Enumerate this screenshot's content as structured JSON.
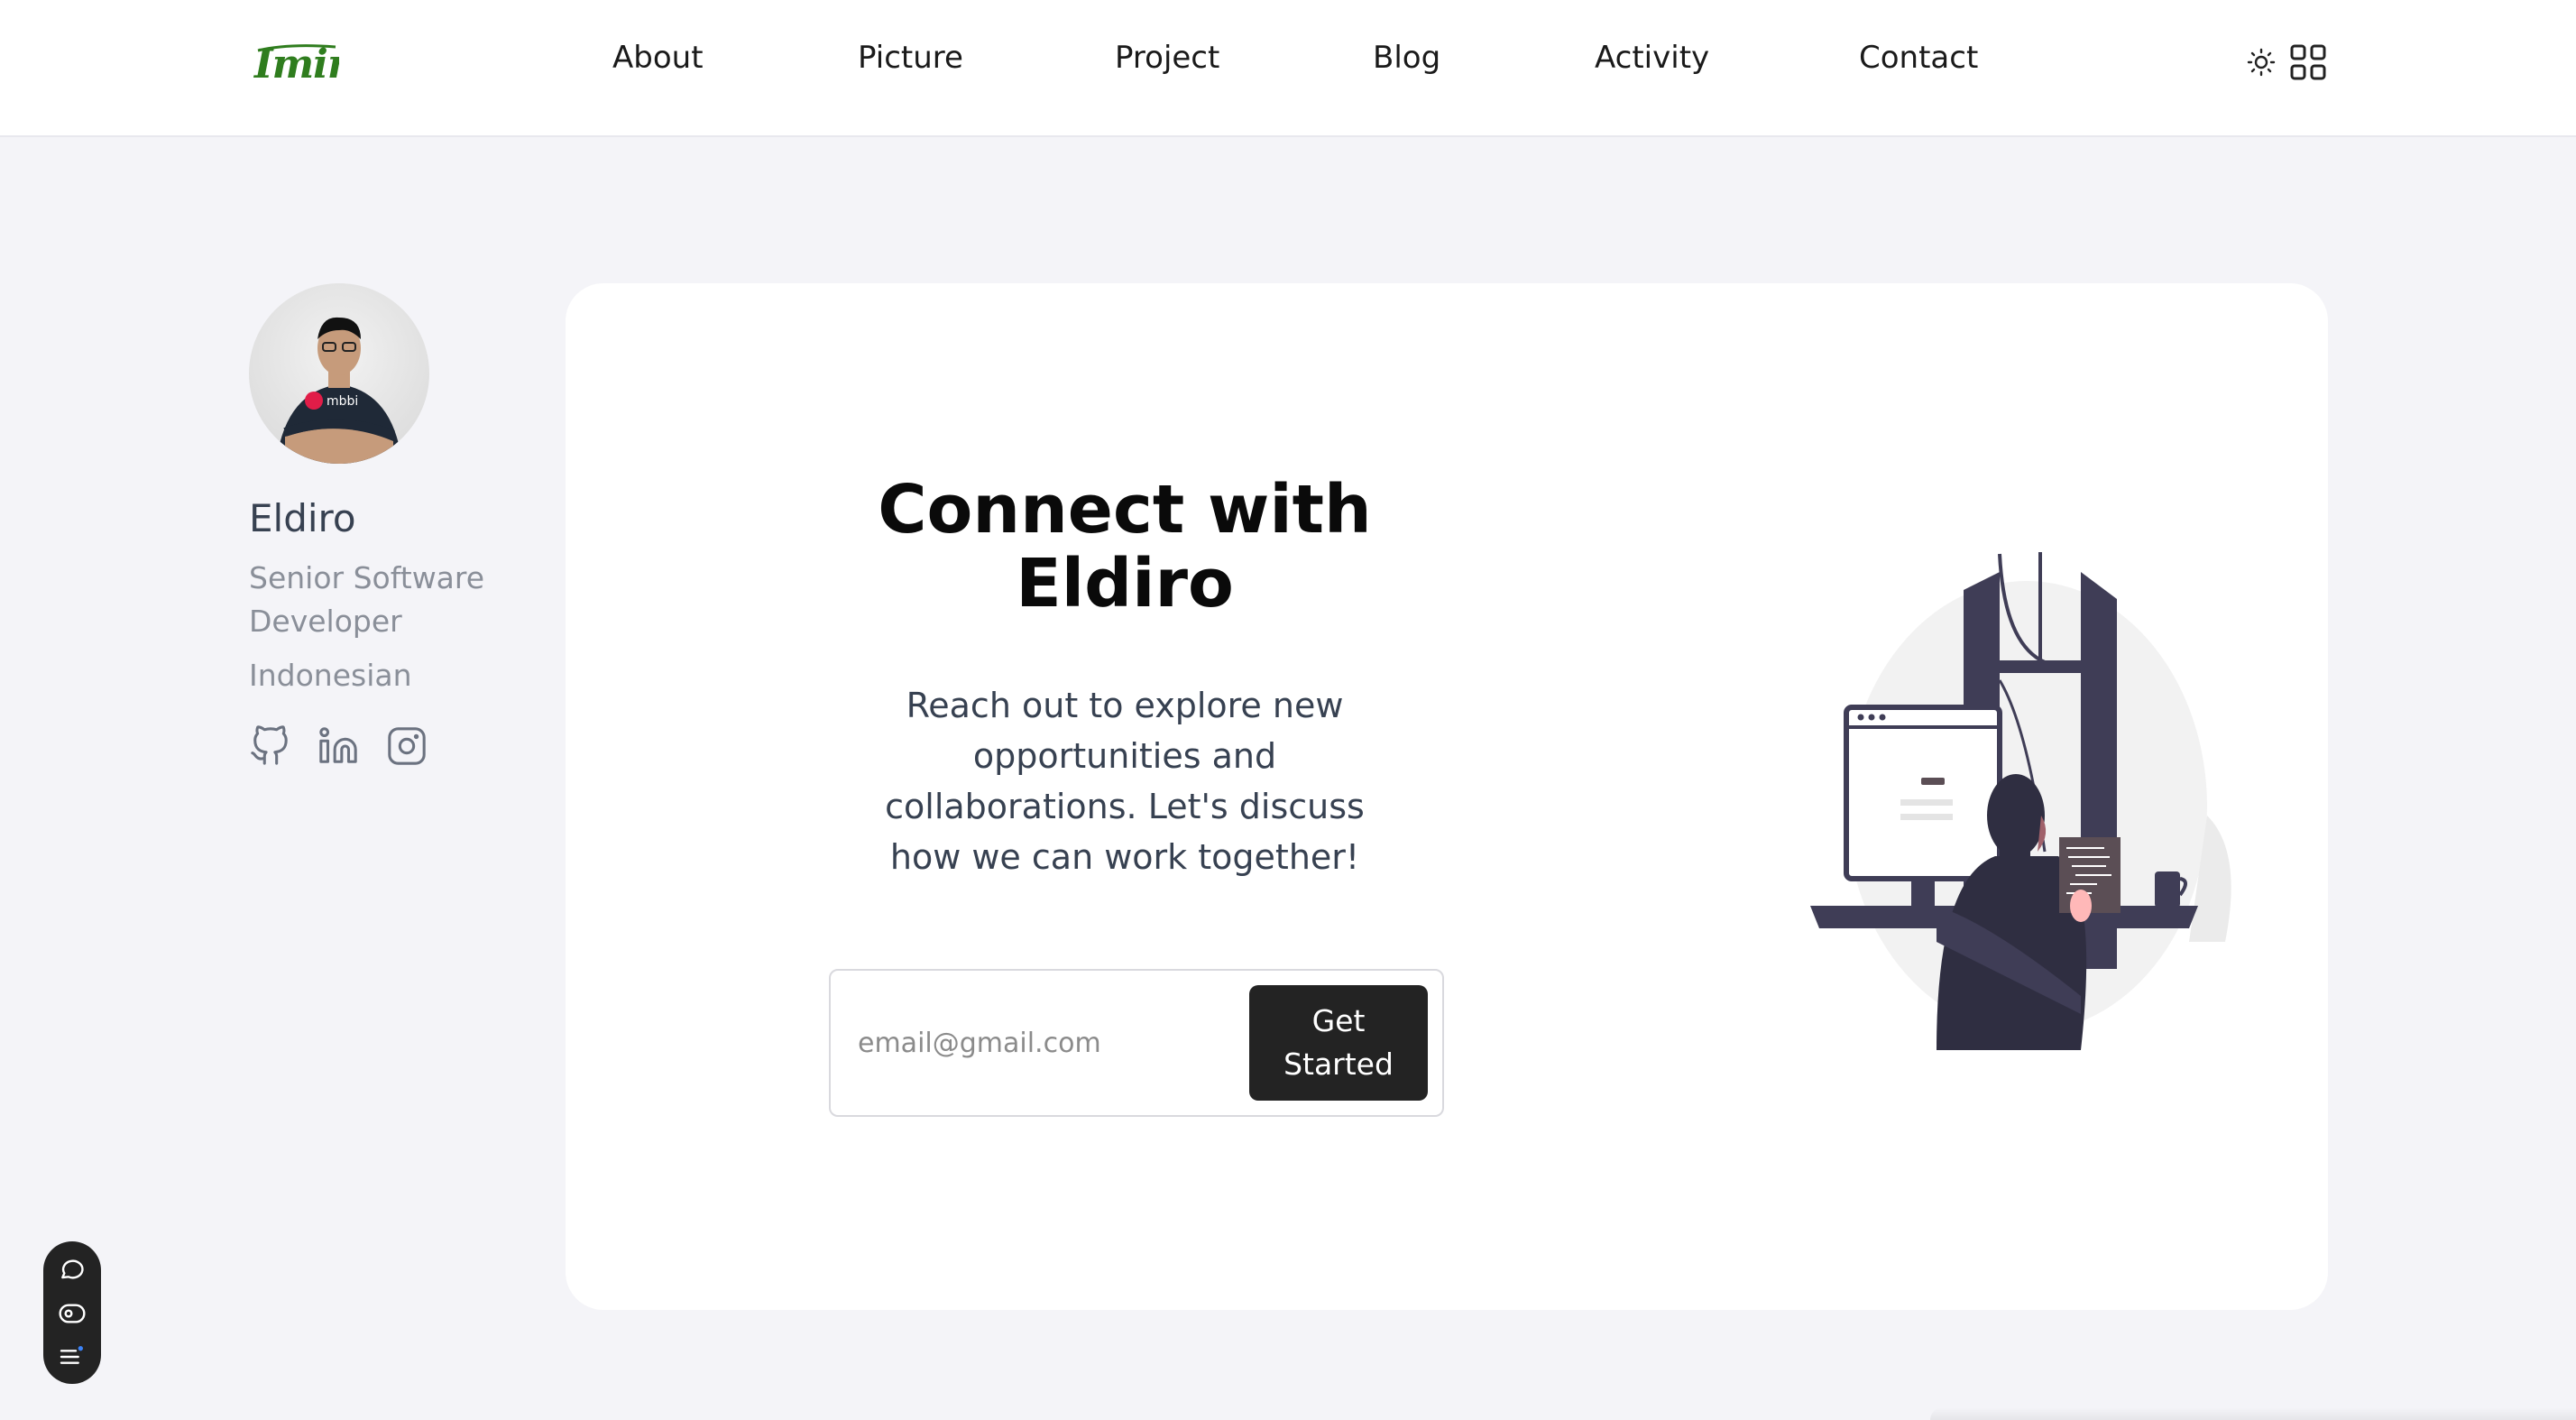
{
  "header": {
    "logo": "Imind",
    "nav": [
      "About",
      "Picture",
      "Project",
      "Blog",
      "Activity",
      "Contact"
    ],
    "icons": [
      "sun-icon",
      "grid-icon"
    ]
  },
  "profile": {
    "name": "Eldiro",
    "role": "Senior Software Developer",
    "nationality": "Indonesian",
    "avatar_shirt_text": "mbbi",
    "socials": [
      "github-icon",
      "linkedin-icon",
      "instagram-icon"
    ]
  },
  "cta": {
    "title": "Connect with Eldiro",
    "description": "Reach out to explore new opportunities and collaborations. Let's discuss how we can work together!",
    "email_placeholder": "email@gmail.com",
    "button_label": "Get Started"
  },
  "widget": {
    "icons": [
      "chat-icon",
      "eye-icon",
      "menu-icon"
    ],
    "accent": "#3b82f6"
  },
  "colors": {
    "logo": "#2f7d1e",
    "button": "#232323",
    "background": "#f4f4f8",
    "illustration_dark": "#3f3d56"
  }
}
